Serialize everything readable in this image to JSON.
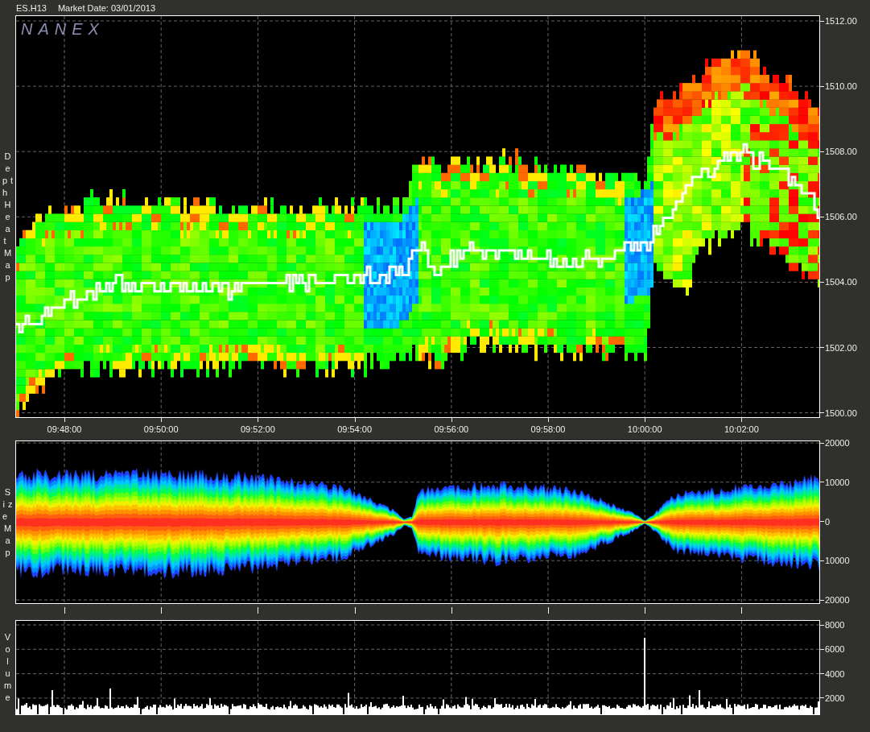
{
  "header": {
    "symbol": "ES.H13",
    "market_date": "Market Date: 03/01/2013"
  },
  "logo": "NANEX",
  "panels": [
    {
      "kind": "heatmap",
      "label": "Depth Heat Map",
      "y_ticks": [
        "1512.00",
        "1510.00",
        "1508.00",
        "1506.00",
        "1504.00",
        "1502.00",
        "1500.00"
      ],
      "x_ticks": [
        "09:48:00",
        "09:50:00",
        "09:52:00",
        "09:54:00",
        "09:56:00",
        "09:58:00",
        "10:00:00",
        "10:02:00"
      ]
    },
    {
      "kind": "sizemap",
      "label": "Size Map",
      "y_ticks": [
        "20000",
        "10000",
        "0",
        "10000",
        "20000"
      ]
    },
    {
      "kind": "volume",
      "label": "Volume",
      "y_ticks": [
        "8000",
        "6000",
        "4000",
        "2000"
      ]
    }
  ]
}
